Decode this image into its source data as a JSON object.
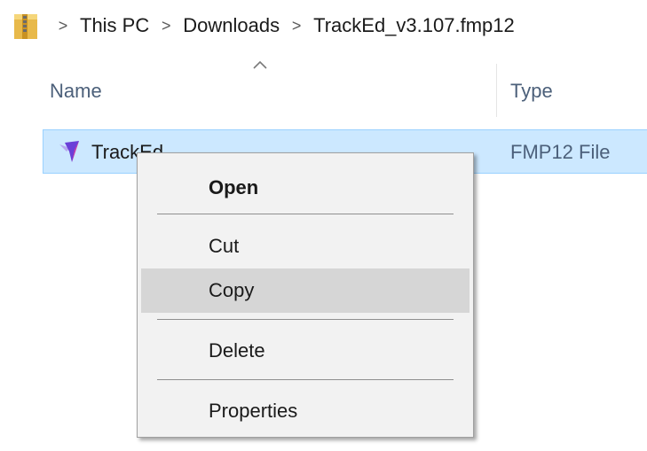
{
  "breadcrumb": {
    "items": [
      "This PC",
      "Downloads",
      "TrackEd_v3.107.fmp12"
    ],
    "separator": ">"
  },
  "columns": {
    "name": "Name",
    "type": "Type"
  },
  "file": {
    "name": "TrackEd",
    "type": "FMP12 File"
  },
  "context_menu": {
    "items": [
      {
        "label": "Open",
        "bold": true
      },
      {
        "label": "Cut"
      },
      {
        "label": "Copy",
        "highlighted": true
      },
      {
        "label": "Delete"
      },
      {
        "label": "Properties"
      }
    ]
  },
  "colors": {
    "selection_fill": "#cce8ff",
    "selection_border": "#99d1ff",
    "menu_background": "#f2f2f2",
    "menu_hover": "#d6d6d6",
    "header_text": "#4c607a"
  },
  "icons": {
    "address_bar": "zip-folder-icon",
    "file": "filemaker-icon",
    "sort": "sort-ascending-icon"
  }
}
